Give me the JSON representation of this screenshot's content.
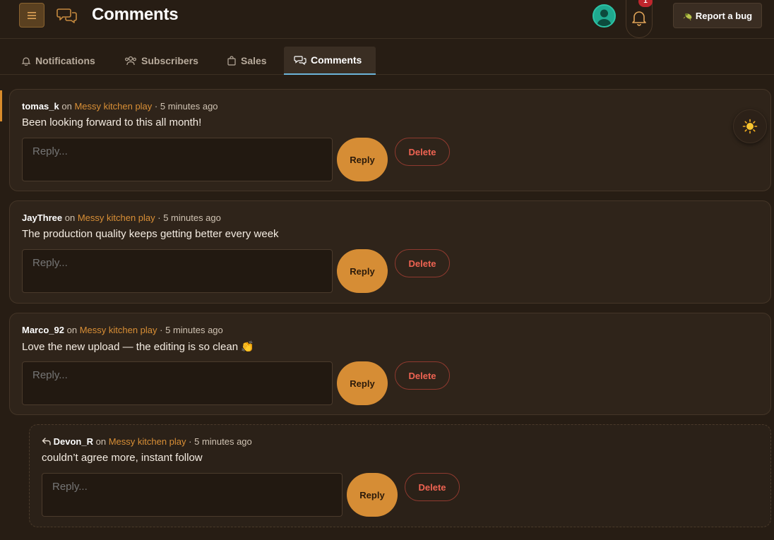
{
  "header": {
    "title": "Comments",
    "bug_button": "Report a bug",
    "notification_count": "1",
    "menu_icon": "hamburger-icon",
    "title_icon": "chat-bubbles-icon"
  },
  "tabs": [
    {
      "label": "Notifications",
      "icon": "bell-icon",
      "active": false
    },
    {
      "label": "Subscribers",
      "icon": "users-icon",
      "active": false
    },
    {
      "label": "Sales",
      "icon": "bag-icon",
      "active": false
    },
    {
      "label": "Comments",
      "icon": "chat-bubbles-icon",
      "active": true
    }
  ],
  "comments": [
    {
      "user": "tomas_k",
      "on": "on",
      "video": "Messy kitchen play",
      "time": "· 5 minutes ago",
      "text": "Been looking forward to this all month!",
      "placeholder": "Reply...",
      "reply_label": "Reply",
      "delete_label": "Delete"
    },
    {
      "user": "JayThree",
      "on": "on",
      "video": "Messy kitchen play",
      "time": "· 5 minutes ago",
      "text": "The production quality keeps getting better every week",
      "placeholder": "Reply...",
      "reply_label": "Reply",
      "delete_label": "Delete"
    },
    {
      "user": "Marco_92",
      "on": "on",
      "video": "Messy kitchen play",
      "time": "· 5 minutes ago",
      "text": "Love the new upload — the editing is so clean 👏",
      "placeholder": "Reply...",
      "reply_label": "Reply",
      "delete_label": "Delete"
    },
    {
      "user": "Devon_R",
      "on": "on",
      "video": "Messy kitchen play",
      "time": "· 5 minutes ago",
      "text": "couldn’t agree more, instant follow",
      "placeholder": "Reply...",
      "reply_label": "Reply",
      "delete_label": "Delete",
      "is_reply": true
    }
  ],
  "colors": {
    "accent": "#d68d35",
    "danger": "#ee6352",
    "background": "#271d14",
    "active_tab_underline": "#6cb4d9"
  }
}
